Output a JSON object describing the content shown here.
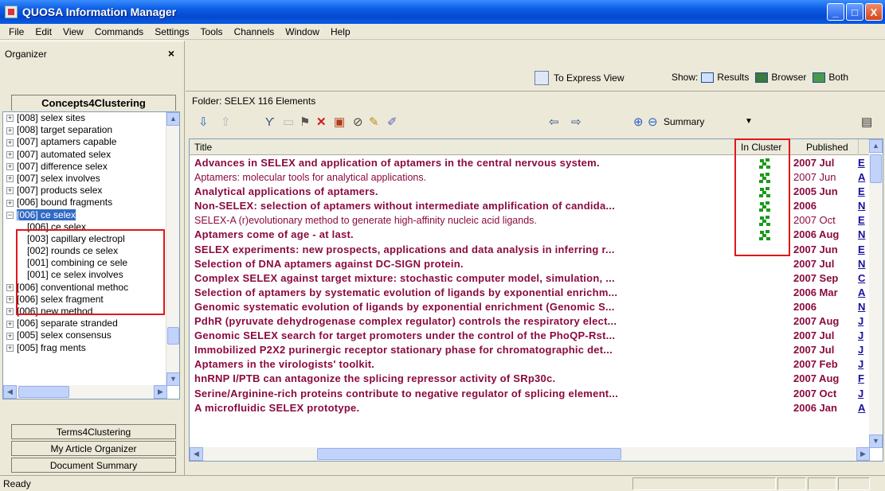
{
  "window": {
    "title": "QUOSA Information Manager",
    "min": "_",
    "max": "□",
    "close": "X"
  },
  "menu": [
    "File",
    "Edit",
    "View",
    "Commands",
    "Settings",
    "Tools",
    "Channels",
    "Window",
    "Help"
  ],
  "organizer": {
    "title": "Organizer",
    "close": "×",
    "active_tab": "Concepts4Clustering",
    "tree": [
      {
        "label": "[008]  selex sites",
        "exp": "+"
      },
      {
        "label": "[008]  target separation",
        "exp": "+"
      },
      {
        "label": "[007]  aptamers capable",
        "exp": "+"
      },
      {
        "label": "[007]  automated selex",
        "exp": "+"
      },
      {
        "label": "[007]  difference selex",
        "exp": "+"
      },
      {
        "label": "[007]  selex involves",
        "exp": "+"
      },
      {
        "label": "[007]  products selex",
        "exp": "+"
      },
      {
        "label": "[006]  bound fragments",
        "exp": "+"
      },
      {
        "label": "[006]  ce selex",
        "exp": "−",
        "selected": true
      },
      {
        "label": "[006]  ce selex",
        "child": true
      },
      {
        "label": "[003]  capillary electropl",
        "child": true
      },
      {
        "label": "[002]  rounds ce selex",
        "child": true
      },
      {
        "label": "[001]  combining ce sele",
        "child": true
      },
      {
        "label": "[001]  ce selex involves",
        "child": true
      },
      {
        "label": "[006]  conventional methoc",
        "exp": "+"
      },
      {
        "label": "[006]  selex fragment",
        "exp": "+"
      },
      {
        "label": "[006]  new method",
        "exp": "+"
      },
      {
        "label": "[006]  separate stranded",
        "exp": "+"
      },
      {
        "label": "[005]  selex consensus",
        "exp": "+"
      },
      {
        "label": "[005]  frag ments",
        "exp": "+"
      }
    ],
    "tabs": [
      "Terms4Clustering",
      "My Article Organizer",
      "Document Summary"
    ]
  },
  "express": {
    "label": "To Express View",
    "show_label": "Show:",
    "results": "Results",
    "browser": "Browser",
    "both": "Both"
  },
  "folder": "Folder: SELEX  116 Elements",
  "toolbar": {
    "summary": "Summary"
  },
  "grid": {
    "columns": {
      "title": "Title",
      "in_cluster": "In Cluster",
      "published": "Published"
    },
    "rows": [
      {
        "title": "Advances in SELEX and application of aptamers in the central nervous system.",
        "bold": true,
        "cluster": true,
        "published": "2007 Jul",
        "x": "E"
      },
      {
        "title": "Aptamers: molecular tools for analytical applications.",
        "bold": false,
        "cluster": true,
        "published": "2007 Jun",
        "x": "A"
      },
      {
        "title": "Analytical applications of aptamers.",
        "bold": true,
        "cluster": true,
        "published": "2005 Jun",
        "x": "E"
      },
      {
        "title": "Non-SELEX: selection of aptamers without intermediate amplification of candida...",
        "bold": true,
        "cluster": true,
        "published": "2006",
        "x": "N"
      },
      {
        "title": "SELEX-A (r)evolutionary method to generate high-affinity nucleic acid ligands.",
        "bold": false,
        "cluster": true,
        "published": "2007 Oct",
        "x": "E"
      },
      {
        "title": "Aptamers come of age - at last.",
        "bold": true,
        "cluster": true,
        "published": "2006 Aug",
        "x": "N"
      },
      {
        "title": "SELEX experiments: new prospects, applications and data analysis in inferring r...",
        "bold": true,
        "cluster": false,
        "published": "2007 Jun",
        "x": "E"
      },
      {
        "title": "Selection of DNA aptamers against DC-SIGN protein.",
        "bold": true,
        "cluster": false,
        "published": "2007 Jul",
        "x": "N"
      },
      {
        "title": "Complex SELEX against target mixture: stochastic computer model, simulation, ...",
        "bold": true,
        "cluster": false,
        "published": "2007 Sep",
        "x": "C"
      },
      {
        "title": "Selection of aptamers by systematic evolution of ligands by exponential enrichm...",
        "bold": true,
        "cluster": false,
        "published": "2006 Mar",
        "x": "A"
      },
      {
        "title": "Genomic systematic evolution of ligands by exponential enrichment (Genomic S...",
        "bold": true,
        "cluster": false,
        "published": "2006",
        "x": "N"
      },
      {
        "title": "PdhR (pyruvate dehydrogenase complex regulator) controls the respiratory elect...",
        "bold": true,
        "cluster": false,
        "published": "2007 Aug",
        "x": "J"
      },
      {
        "title": "Genomic SELEX search for target promoters under the control of the PhoQP-Rst...",
        "bold": true,
        "cluster": false,
        "published": "2007 Jul",
        "x": "J"
      },
      {
        "title": "Immobilized P2X2 purinergic receptor stationary phase for chromatographic det...",
        "bold": true,
        "cluster": false,
        "published": "2007 Jul",
        "x": "J"
      },
      {
        "title": "Aptamers in the virologists' toolkit.",
        "bold": true,
        "cluster": false,
        "published": "2007 Feb",
        "x": "J"
      },
      {
        "title": "hnRNP I/PTB can antagonize the splicing repressor activity of SRp30c.",
        "bold": true,
        "cluster": false,
        "published": "2007 Aug",
        "x": "F"
      },
      {
        "title": "Serine/Arginine-rich proteins contribute to negative regulator of splicing element...",
        "bold": true,
        "cluster": false,
        "published": "2007 Oct",
        "x": "J"
      },
      {
        "title": "A microfluidic SELEX prototype.",
        "bold": true,
        "cluster": false,
        "published": "2006 Jan",
        "x": "A"
      }
    ]
  },
  "status": "Ready",
  "colors": {
    "title_text": "#8b0a3f",
    "highlight_box": "#e01818",
    "selection": "#316ac5"
  }
}
